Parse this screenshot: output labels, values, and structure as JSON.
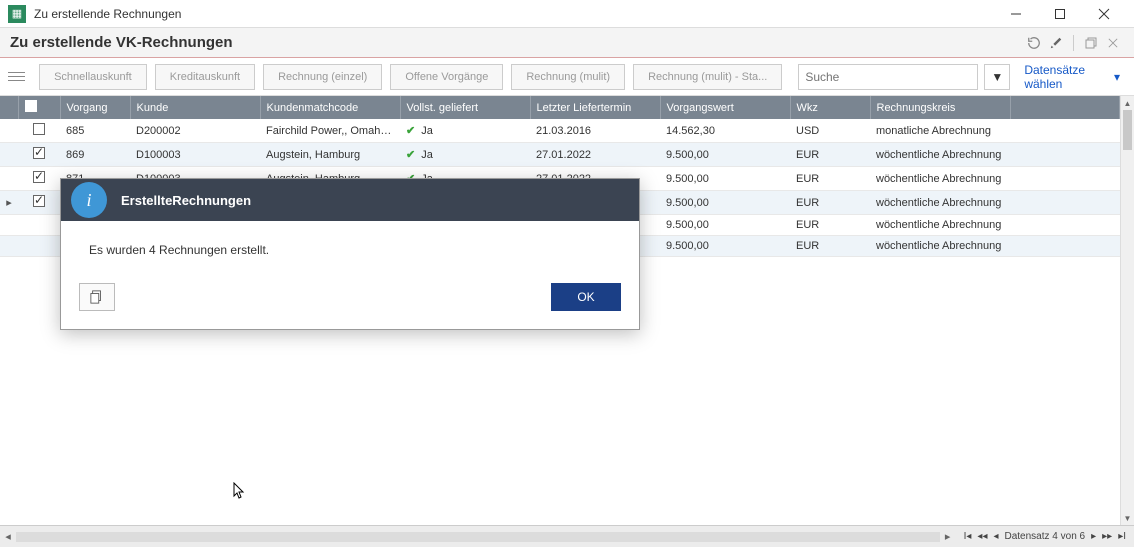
{
  "window": {
    "title": "Zu erstellende Rechnungen"
  },
  "page": {
    "heading": "Zu erstellende VK-Rechnungen"
  },
  "toolbar": {
    "schnellauskunft": "Schnellauskunft",
    "kreditauskunft": "Kreditauskunft",
    "rechnung_einzel": "Rechnung (einzel)",
    "offene_vorgaenge": "Offene Vorgänge",
    "rechnung_multi": "Rechnung (mulit)",
    "rechnung_multi_sta": "Rechnung (mulit) - Sta...",
    "search_placeholder": "Suche",
    "select_records": "Datensätze wählen"
  },
  "grid": {
    "columns": {
      "vorgang": "Vorgang",
      "kunde": "Kunde",
      "match": "Kundenmatchcode",
      "voll": "Vollst. geliefert",
      "termin": "Letzter Liefertermin",
      "wert": "Vorgangswert",
      "wkz": "Wkz",
      "kreis": "Rechnungskreis"
    },
    "rows": [
      {
        "checked": false,
        "vorgang": "685",
        "kunde": "D200002",
        "match": "Fairchild Power,, Omaha (N...",
        "voll": "Ja",
        "termin": "21.03.2016",
        "wert": "14.562,30",
        "wkz": "USD",
        "kreis": "monatliche Abrechnung"
      },
      {
        "checked": true,
        "vorgang": "869",
        "kunde": "D100003",
        "match": "Augstein, Hamburg",
        "voll": "Ja",
        "termin": "27.01.2022",
        "wert": "9.500,00",
        "wkz": "EUR",
        "kreis": "wöchentliche Abrechnung"
      },
      {
        "checked": true,
        "vorgang": "871",
        "kunde": "D100003",
        "match": "Augstein, Hamburg",
        "voll": "Ja",
        "termin": "27.01.2022",
        "wert": "9.500,00",
        "wkz": "EUR",
        "kreis": "wöchentliche Abrechnung"
      },
      {
        "checked": true,
        "vorgang": "",
        "kunde": "",
        "match": "",
        "voll": "",
        "termin": "",
        "wert": "9.500,00",
        "wkz": "EUR",
        "kreis": "wöchentliche Abrechnung",
        "indicator": "▸"
      },
      {
        "checked": null,
        "vorgang": "",
        "kunde": "",
        "match": "",
        "voll": "",
        "termin": "",
        "wert": "9.500,00",
        "wkz": "EUR",
        "kreis": "wöchentliche Abrechnung"
      },
      {
        "checked": null,
        "vorgang": "",
        "kunde": "",
        "match": "",
        "voll": "",
        "termin": "",
        "wert": "9.500,00",
        "wkz": "EUR",
        "kreis": "wöchentliche Abrechnung"
      }
    ]
  },
  "dialog": {
    "title": "ErstellteRechnungen",
    "message": "Es wurden 4 Rechnungen erstellt.",
    "ok": "OK"
  },
  "status": {
    "record_text": "Datensatz 4 von 6"
  }
}
